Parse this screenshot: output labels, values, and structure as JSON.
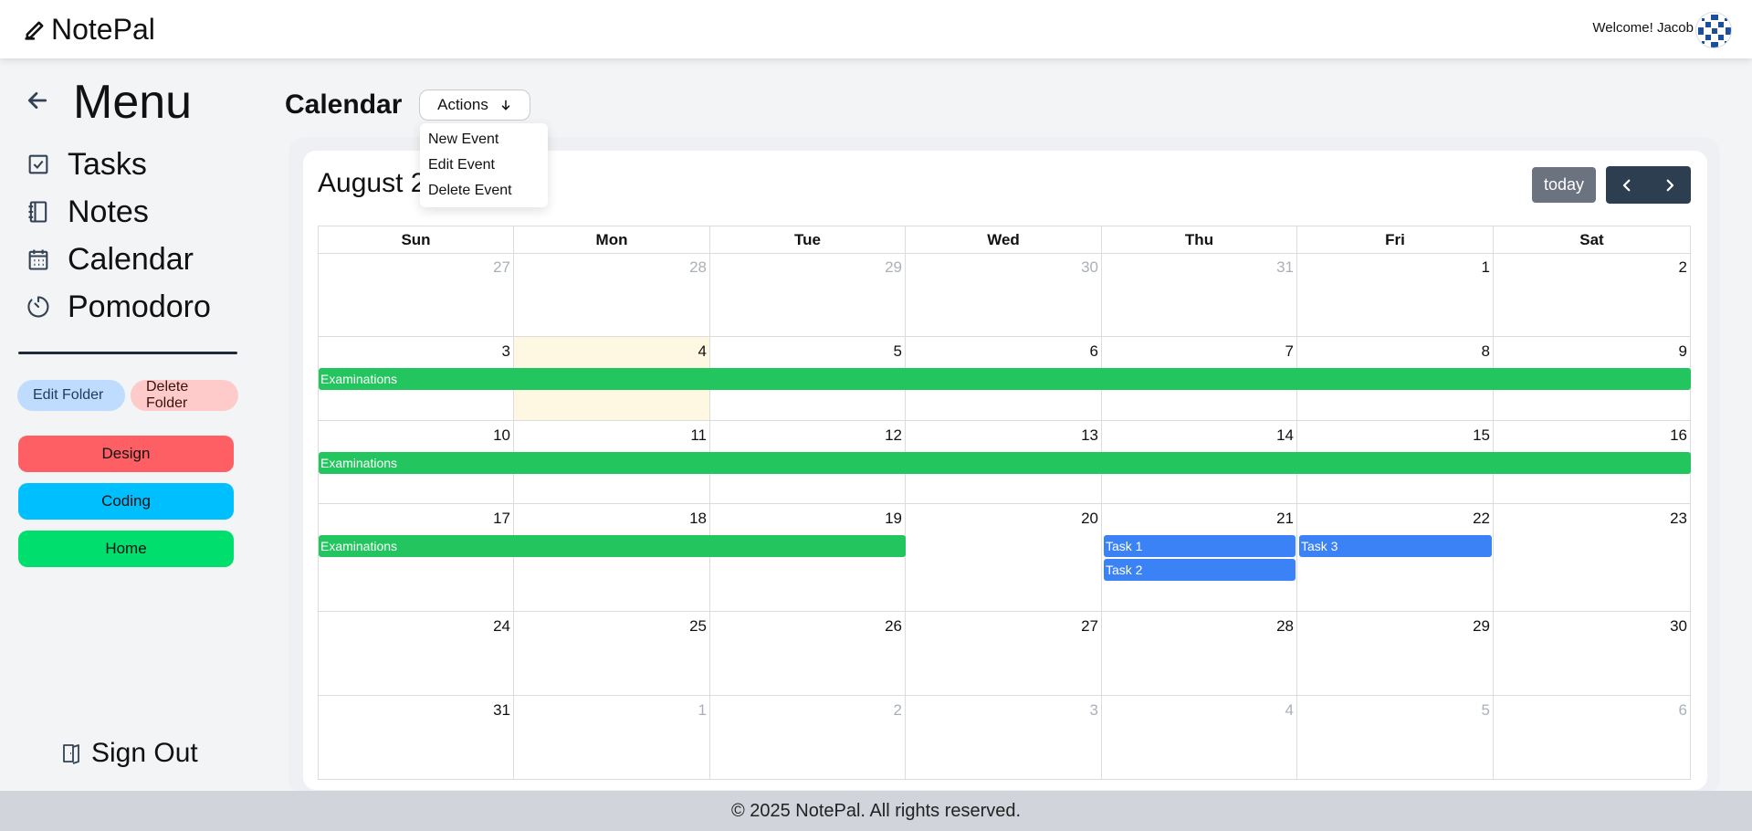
{
  "app": {
    "name": "NotePal",
    "welcome": "Welcome! Jacob"
  },
  "sidebar": {
    "menu_title": "Menu",
    "nav": [
      {
        "label": "Tasks",
        "icon": "checkbox-icon"
      },
      {
        "label": "Notes",
        "icon": "notebook-icon"
      },
      {
        "label": "Calendar",
        "icon": "calendar-icon"
      },
      {
        "label": "Pomodoro",
        "icon": "timer-icon"
      }
    ],
    "edit_folder": "Edit Folder",
    "delete_folder": "Delete Folder",
    "folders": [
      {
        "label": "Design",
        "color": "#fe5f64"
      },
      {
        "label": "Coding",
        "color": "#00bfff"
      },
      {
        "label": "Home",
        "color": "#00de6e"
      }
    ],
    "sign_out": "Sign Out"
  },
  "main": {
    "title": "Calendar",
    "actions_label": "Actions",
    "actions_menu": [
      "New Event",
      "Edit Event",
      "Delete Event"
    ]
  },
  "calendar": {
    "month_title": "August 2",
    "today_label": "today",
    "weekdays": [
      "Sun",
      "Mon",
      "Tue",
      "Wed",
      "Thu",
      "Fri",
      "Sat"
    ],
    "weeks": [
      [
        {
          "d": "27",
          "other": true
        },
        {
          "d": "28",
          "other": true
        },
        {
          "d": "29",
          "other": true
        },
        {
          "d": "30",
          "other": true
        },
        {
          "d": "31",
          "other": true
        },
        {
          "d": "1"
        },
        {
          "d": "2"
        }
      ],
      [
        {
          "d": "3"
        },
        {
          "d": "4",
          "today": true
        },
        {
          "d": "5"
        },
        {
          "d": "6"
        },
        {
          "d": "7"
        },
        {
          "d": "8"
        },
        {
          "d": "9"
        }
      ],
      [
        {
          "d": "10"
        },
        {
          "d": "11"
        },
        {
          "d": "12"
        },
        {
          "d": "13"
        },
        {
          "d": "14"
        },
        {
          "d": "15"
        },
        {
          "d": "16"
        }
      ],
      [
        {
          "d": "17"
        },
        {
          "d": "18"
        },
        {
          "d": "19"
        },
        {
          "d": "20"
        },
        {
          "d": "21"
        },
        {
          "d": "22"
        },
        {
          "d": "23"
        }
      ],
      [
        {
          "d": "24"
        },
        {
          "d": "25"
        },
        {
          "d": "26"
        },
        {
          "d": "27"
        },
        {
          "d": "28"
        },
        {
          "d": "29"
        },
        {
          "d": "30"
        }
      ],
      [
        {
          "d": "31"
        },
        {
          "d": "1",
          "other": true
        },
        {
          "d": "2",
          "other": true
        },
        {
          "d": "3",
          "other": true
        },
        {
          "d": "4",
          "other": true
        },
        {
          "d": "5",
          "other": true
        },
        {
          "d": "6",
          "other": true
        }
      ]
    ],
    "events": [
      {
        "title": "Examinations",
        "color": "green",
        "week": 1,
        "start": 0,
        "end": 6
      },
      {
        "title": "Examinations",
        "color": "green",
        "week": 2,
        "start": 0,
        "end": 6
      },
      {
        "title": "Examinations",
        "color": "green",
        "week": 3,
        "start": 0,
        "end": 2
      },
      {
        "title": "Task 1",
        "color": "blue",
        "week": 3,
        "start": 4,
        "end": 4
      },
      {
        "title": "Task 2",
        "color": "blue",
        "week": 3,
        "start": 4,
        "end": 4
      },
      {
        "title": "Task 3",
        "color": "blue",
        "week": 3,
        "start": 5,
        "end": 5
      }
    ]
  },
  "footer": {
    "text": "© 2025 NotePal. All rights reserved."
  }
}
